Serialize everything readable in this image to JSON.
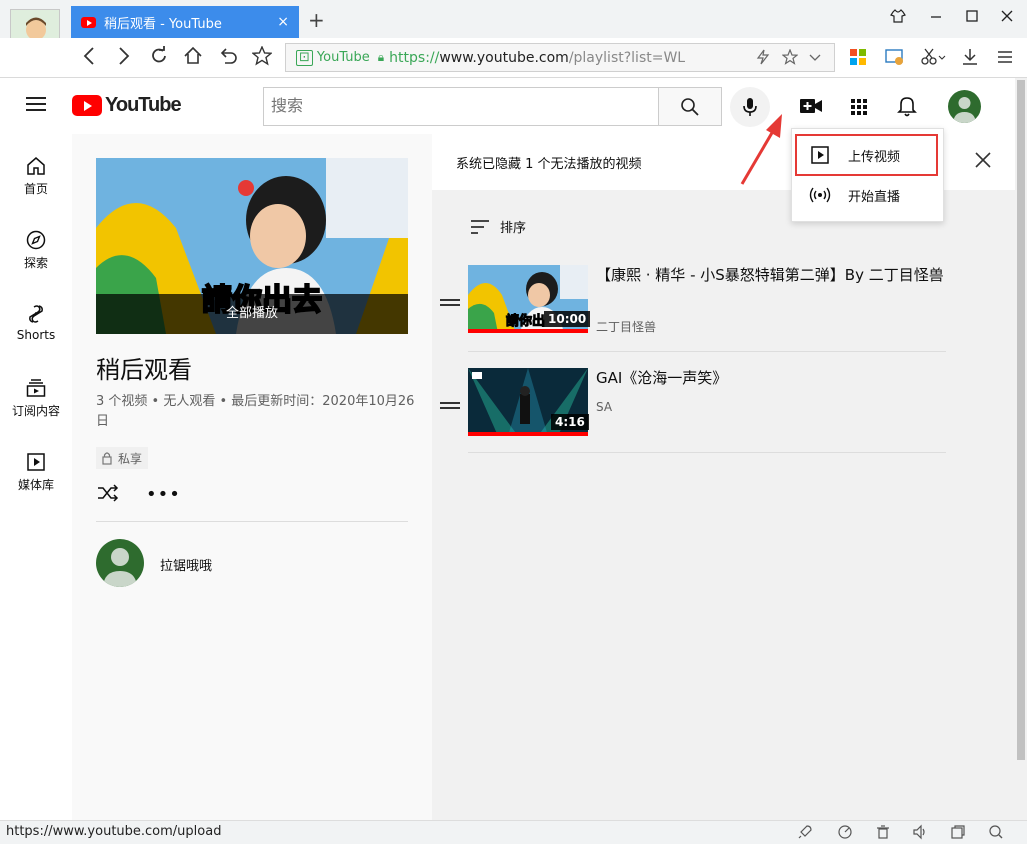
{
  "browser": {
    "tab_title": "稍后观看 - YouTube",
    "tab_close": "×",
    "new_tab": "+",
    "address": {
      "badge_label": "YouTube",
      "protocol": "https://",
      "domain": "www.youtube.com",
      "path": "/playlist?list=WL"
    },
    "status_url": "https://www.youtube.com/upload"
  },
  "masthead": {
    "logo_text": "YouTube",
    "search_placeholder": "搜索"
  },
  "guide": {
    "items": [
      {
        "label": "首页",
        "icon": "home-icon"
      },
      {
        "label": "探索",
        "icon": "compass-icon"
      },
      {
        "label": "Shorts",
        "icon": "shorts-icon"
      },
      {
        "label": "订阅内容",
        "icon": "subscriptions-icon"
      },
      {
        "label": "媒体库",
        "icon": "library-icon"
      }
    ]
  },
  "playlist": {
    "play_all": "全部播放",
    "title": "稍后观看",
    "meta": "3 个视频 • 无人观看 • 最后更新时间：2020年10月26日",
    "privacy": "私享",
    "owner": "拉锯哦哦"
  },
  "notice": {
    "text": "系统已隐藏 1 个无法播放的视频"
  },
  "sort_label": "排序",
  "videos": [
    {
      "title": "【康熙 · 精华 - 小S暴怒特辑第二弹】By 二丁目怪兽",
      "channel": "二丁目怪兽",
      "duration": "10:00"
    },
    {
      "title": "GAI《沧海一声笑》",
      "channel": "SA",
      "duration": "4:16"
    }
  ],
  "create_menu": {
    "items": [
      {
        "label": "上传视频",
        "icon": "upload-video-icon"
      },
      {
        "label": "开始直播",
        "icon": "go-live-icon"
      }
    ]
  },
  "colors": {
    "accent_red": "#ff0000",
    "highlight_red": "#e53935",
    "tab_blue": "#3c8ceb",
    "secure_green": "#3aa757"
  }
}
